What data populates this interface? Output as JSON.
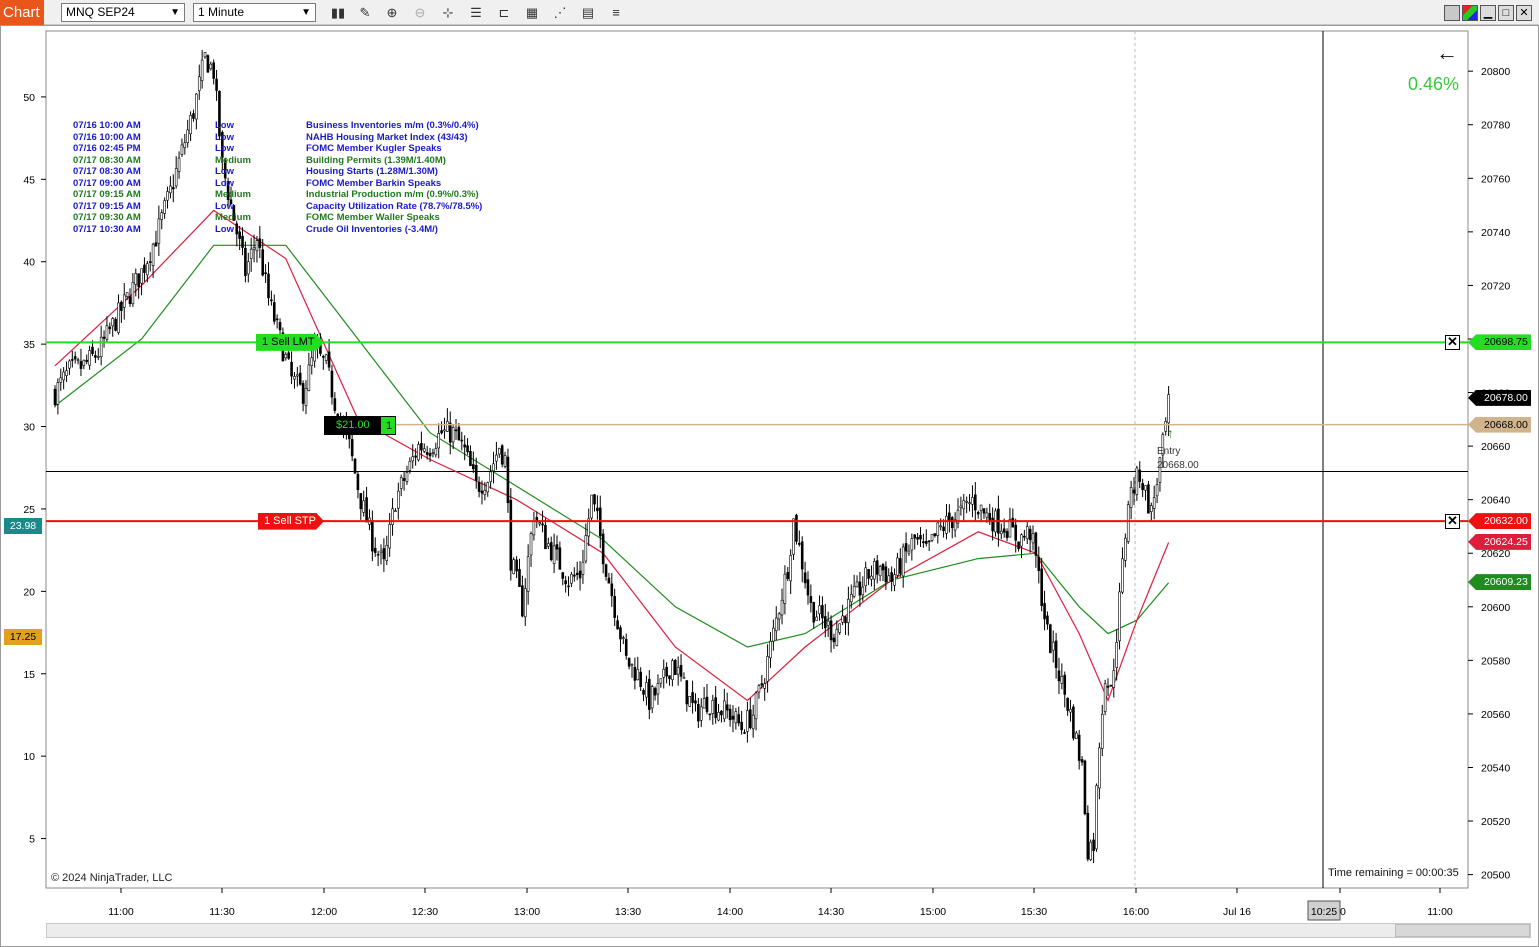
{
  "toolbar": {
    "tab_label": "Chart",
    "instrument": "MNQ SEP24",
    "interval": "1 Minute"
  },
  "events": [
    {
      "time": "07/16 10:00 AM",
      "impact": "Low",
      "title": "Business Inventories m/m (0.3%/0.4%)",
      "color": "#1a1acc"
    },
    {
      "time": "07/16 10:00 AM",
      "impact": "Low",
      "title": "NAHB Housing Market Index (43/43)",
      "color": "#1a1acc"
    },
    {
      "time": "07/16 02:45 PM",
      "impact": "Low",
      "title": "FOMC Member Kugler Speaks",
      "color": "#1a1acc"
    },
    {
      "time": "07/17 08:30 AM",
      "impact": "Medium",
      "title": "Building Permits (1.39M/1.40M)",
      "color": "#1e7a1e"
    },
    {
      "time": "07/17 08:30 AM",
      "impact": "Low",
      "title": "Housing Starts (1.28M/1.30M)",
      "color": "#1a1acc"
    },
    {
      "time": "07/17 09:00 AM",
      "impact": "Low",
      "title": "FOMC Member Barkin Speaks",
      "color": "#1a1acc"
    },
    {
      "time": "07/17 09:15 AM",
      "impact": "Medium",
      "title": "Industrial Production m/m (0.9%/0.3%)",
      "color": "#1e7a1e"
    },
    {
      "time": "07/17 09:15 AM",
      "impact": "Low",
      "title": "Capacity Utilization Rate (78.7%/78.5%)",
      "color": "#1a1acc"
    },
    {
      "time": "07/17 09:30 AM",
      "impact": "Medium",
      "title": "FOMC Member Waller Speaks",
      "color": "#1e7a1e"
    },
    {
      "time": "07/17 10:30 AM",
      "impact": "Low",
      "title": "Crude Oil Inventories (-3.4M/)",
      "color": "#1a1acc"
    }
  ],
  "indicator": {
    "change_percent": "0.46%",
    "copyright": "© 2024 NinjaTrader, LLC",
    "time_remaining": "Time remaining = 00:00:35"
  },
  "orders": {
    "sell_lmt": {
      "qty": "1",
      "label": "Sell LMT",
      "price": 20698.75,
      "price_label": "20698.75",
      "color": "#22dd22"
    },
    "sell_stp": {
      "qty": "1",
      "label": "Sell STP",
      "price": 20632.0,
      "price_label": "20632.00",
      "color": "#ee1111"
    },
    "position": {
      "pnl": "$21.00",
      "qty": "1",
      "price": 20668.0,
      "price_label": "20668.00",
      "color": "#d2b48c"
    },
    "entry_label": "Entry",
    "entry_price_label": "20668.00"
  },
  "price_tags": {
    "last": {
      "price": 20678.0,
      "label": "20678.00",
      "color": "#000000"
    },
    "ema_red": {
      "price": 20624.25,
      "label": "20624.25",
      "color": "#dc1e3c"
    },
    "ema_green": {
      "price": 20609.23,
      "label": "20609.23",
      "color": "#1e8c1e"
    },
    "crosshair": {
      "price": 20650.5
    }
  },
  "left_tags": {
    "teal": {
      "value": 23.98,
      "label": "23.98",
      "color": "#1a8a8a"
    },
    "orange": {
      "value": 17.25,
      "label": "17.25",
      "color": "#e0a020"
    }
  },
  "x_axis_current": "10:25",
  "chart_data": {
    "type": "candlestick",
    "price_axis": {
      "ticks": [
        20500,
        20520,
        20540,
        20560,
        20580,
        20600,
        20620,
        20640,
        20660,
        20680,
        20700,
        20720,
        20740,
        20760,
        20780,
        20800
      ],
      "range": [
        20495,
        20815
      ]
    },
    "left_axis": {
      "ticks": [
        5,
        10,
        15,
        20,
        25,
        30,
        35,
        40,
        45,
        50
      ],
      "range": [
        2,
        54
      ]
    },
    "x_axis": {
      "ticks": [
        "11:00",
        "11:30",
        "12:00",
        "12:30",
        "13:00",
        "13:30",
        "14:00",
        "14:30",
        "15:00",
        "15:30",
        "16:00",
        "Jul 16",
        "30",
        "11:00"
      ]
    },
    "close_path": [
      [
        0,
        20680
      ],
      [
        5,
        20688
      ],
      [
        10,
        20690
      ],
      [
        15,
        20695
      ],
      [
        20,
        20705
      ],
      [
        25,
        20715
      ],
      [
        30,
        20725
      ],
      [
        35,
        20738
      ],
      [
        40,
        20755
      ],
      [
        44,
        20770
      ],
      [
        48,
        20785
      ],
      [
        50,
        20795
      ],
      [
        52,
        20805
      ],
      [
        55,
        20800
      ],
      [
        58,
        20765
      ],
      [
        62,
        20745
      ],
      [
        66,
        20725
      ],
      [
        70,
        20738
      ],
      [
        74,
        20715
      ],
      [
        78,
        20700
      ],
      [
        82,
        20685
      ],
      [
        86,
        20680
      ],
      [
        90,
        20695
      ],
      [
        94,
        20690
      ],
      [
        98,
        20672
      ],
      [
        102,
        20660
      ],
      [
        106,
        20640
      ],
      [
        110,
        20625
      ],
      [
        114,
        20615
      ],
      [
        118,
        20640
      ],
      [
        122,
        20650
      ],
      [
        126,
        20660
      ],
      [
        130,
        20660
      ],
      [
        134,
        20665
      ],
      [
        138,
        20665
      ],
      [
        142,
        20658
      ],
      [
        146,
        20645
      ],
      [
        150,
        20648
      ],
      [
        154,
        20660
      ],
      [
        156,
        20655
      ],
      [
        158,
        20618
      ],
      [
        162,
        20600
      ],
      [
        166,
        20635
      ],
      [
        170,
        20625
      ],
      [
        174,
        20618
      ],
      [
        178,
        20610
      ],
      [
        182,
        20612
      ],
      [
        186,
        20640
      ],
      [
        188,
        20632
      ],
      [
        190,
        20620
      ],
      [
        194,
        20600
      ],
      [
        198,
        20580
      ],
      [
        202,
        20575
      ],
      [
        206,
        20565
      ],
      [
        210,
        20570
      ],
      [
        214,
        20580
      ],
      [
        218,
        20570
      ],
      [
        222,
        20560
      ],
      [
        226,
        20565
      ],
      [
        230,
        20562
      ],
      [
        234,
        20560
      ],
      [
        238,
        20555
      ],
      [
        242,
        20560
      ],
      [
        246,
        20575
      ],
      [
        250,
        20595
      ],
      [
        254,
        20615
      ],
      [
        256,
        20632
      ],
      [
        258,
        20622
      ],
      [
        262,
        20600
      ],
      [
        266,
        20595
      ],
      [
        270,
        20590
      ],
      [
        274,
        20598
      ],
      [
        278,
        20605
      ],
      [
        282,
        20612
      ],
      [
        286,
        20615
      ],
      [
        290,
        20610
      ],
      [
        294,
        20618
      ],
      [
        298,
        20625
      ],
      [
        302,
        20620
      ],
      [
        306,
        20628
      ],
      [
        310,
        20632
      ],
      [
        314,
        20635
      ],
      [
        318,
        20640
      ],
      [
        322,
        20635
      ],
      [
        326,
        20632
      ],
      [
        330,
        20630
      ],
      [
        334,
        20625
      ],
      [
        338,
        20628
      ],
      [
        340,
        20618
      ],
      [
        344,
        20590
      ],
      [
        348,
        20575
      ],
      [
        352,
        20560
      ],
      [
        356,
        20540
      ],
      [
        358,
        20510
      ],
      [
        360,
        20512
      ],
      [
        362,
        20550
      ],
      [
        364,
        20575
      ],
      [
        366,
        20568
      ],
      [
        368,
        20590
      ],
      [
        372,
        20640
      ],
      [
        376,
        20650
      ],
      [
        380,
        20635
      ],
      [
        384,
        20660
      ],
      [
        386,
        20675
      ]
    ],
    "ema_red_path": [
      [
        0,
        20690
      ],
      [
        30,
        20720
      ],
      [
        55,
        20748
      ],
      [
        80,
        20730
      ],
      [
        105,
        20670
      ],
      [
        130,
        20655
      ],
      [
        160,
        20640
      ],
      [
        190,
        20620
      ],
      [
        215,
        20585
      ],
      [
        240,
        20565
      ],
      [
        260,
        20585
      ],
      [
        290,
        20610
      ],
      [
        320,
        20628
      ],
      [
        340,
        20620
      ],
      [
        355,
        20590
      ],
      [
        365,
        20565
      ],
      [
        375,
        20595
      ],
      [
        386,
        20624
      ]
    ],
    "ema_green_path": [
      [
        0,
        20675
      ],
      [
        30,
        20700
      ],
      [
        55,
        20735
      ],
      [
        80,
        20735
      ],
      [
        105,
        20700
      ],
      [
        130,
        20665
      ],
      [
        160,
        20645
      ],
      [
        190,
        20625
      ],
      [
        215,
        20600
      ],
      [
        240,
        20585
      ],
      [
        260,
        20590
      ],
      [
        290,
        20610
      ],
      [
        320,
        20618
      ],
      [
        340,
        20620
      ],
      [
        355,
        20600
      ],
      [
        365,
        20590
      ],
      [
        375,
        20595
      ],
      [
        386,
        20609
      ]
    ]
  }
}
